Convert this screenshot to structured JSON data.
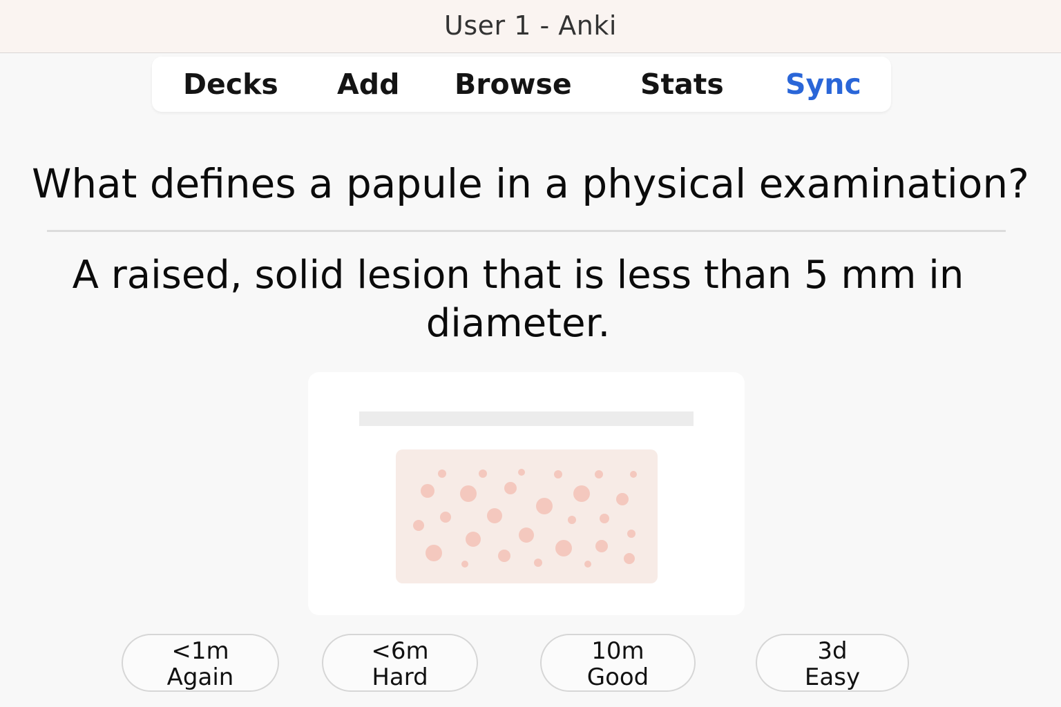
{
  "window": {
    "title": "User 1 - Anki"
  },
  "toolbar": {
    "items": [
      {
        "label": "Decks",
        "active": false
      },
      {
        "label": "Add",
        "active": false
      },
      {
        "label": "Browse",
        "active": false
      },
      {
        "label": "Stats",
        "active": false
      },
      {
        "label": "Sync",
        "active": true
      }
    ],
    "active_color": "#2a66d8"
  },
  "card": {
    "question": "What defines a papule in a physical examination?",
    "answer": "A raised, solid lesion that is less than 5 mm in diameter.",
    "image": {
      "icon": "skin-papules-illustration",
      "skin_color": "#f7ebe6",
      "papule_color": "#f4c8be"
    }
  },
  "answer_buttons": [
    {
      "interval": "<1m",
      "label": "Again"
    },
    {
      "interval": "<6m",
      "label": "Hard"
    },
    {
      "interval": "10m",
      "label": "Good"
    },
    {
      "interval": "3d",
      "label": "Easy"
    }
  ]
}
